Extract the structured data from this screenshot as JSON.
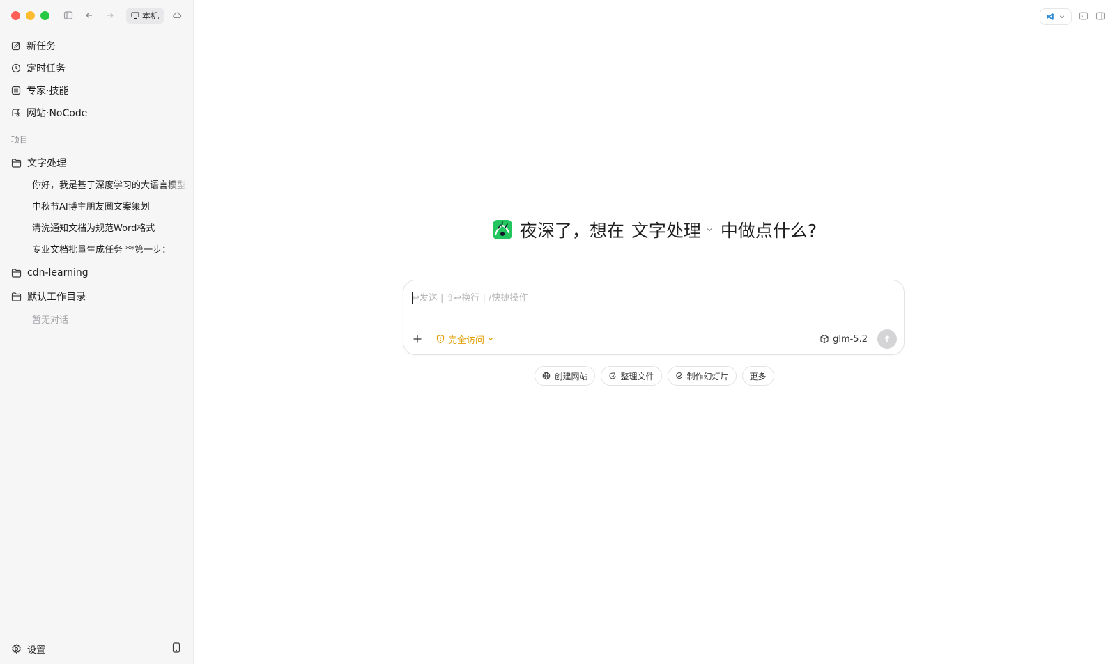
{
  "titlebar": {
    "local_label": "本机"
  },
  "nav": {
    "items": [
      {
        "label": "新任务",
        "icon": "edit-icon"
      },
      {
        "label": "定时任务",
        "icon": "clock-icon"
      },
      {
        "label": "专家·技能",
        "icon": "expert-icon"
      },
      {
        "label": "网站·NoCode",
        "icon": "website-icon"
      }
    ]
  },
  "projects": {
    "section_label": "项目",
    "items": [
      {
        "name": "文字处理",
        "conversations": [
          "你好，我是基于深度学习的大语言模型",
          "中秋节AI博主朋友圈文案策划",
          "清洗通知文档为规范Word格式",
          "专业文档批量生成任务 **第一步："
        ]
      },
      {
        "name": "cdn-learning",
        "conversations": []
      },
      {
        "name": "默认工作目录",
        "conversations": [],
        "empty_text": "暂无对话"
      }
    ]
  },
  "footer": {
    "settings_label": "设置"
  },
  "hero": {
    "prefix": "夜深了，想在",
    "project": "文字处理",
    "suffix": "中做点什么?"
  },
  "composer": {
    "placeholder": "↩发送 | ⇧↩换行 | /快捷操作",
    "access_label": "完全访问",
    "model_label": "glm-5.2"
  },
  "chips": [
    {
      "label": "创建网站",
      "icon": "globe-icon"
    },
    {
      "label": "整理文件",
      "icon": "organize-icon"
    },
    {
      "label": "制作幻灯片",
      "icon": "slides-icon"
    },
    {
      "label": "更多",
      "icon": ""
    }
  ],
  "colors": {
    "accent_warning": "#e3a008",
    "brand_green": "#22c55e",
    "sidebar_bg": "#f6f6f7"
  }
}
